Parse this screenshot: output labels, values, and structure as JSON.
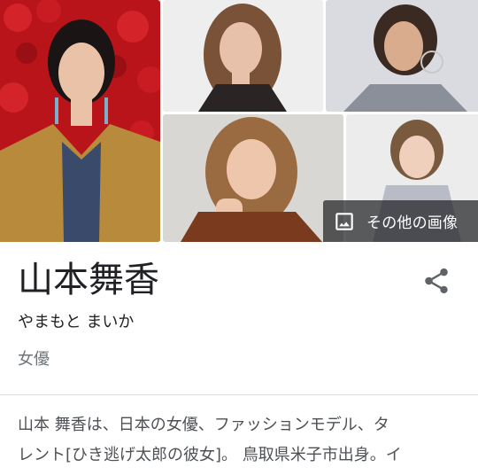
{
  "gallery": {
    "images": [
      {
        "name": "photo-1",
        "colors": {
          "bg": "#b8141a",
          "skin": "#e9c2a8",
          "hair": "#1b1414",
          "coat": "#b88a3c",
          "accent": "#3a4a6a"
        }
      },
      {
        "name": "photo-2",
        "colors": {
          "bg": "#eeeeee",
          "skin": "#e8c1aa",
          "hair": "#7a5238",
          "cloth": "#2a2424"
        }
      },
      {
        "name": "photo-3",
        "colors": {
          "bg": "#d9dbe0",
          "skin": "#d9ac8e",
          "hair": "#3a2a22",
          "cloth": "#8a8f9a"
        }
      },
      {
        "name": "photo-4",
        "colors": {
          "bg": "#d9d7d4",
          "skin": "#eec6ac",
          "hair": "#9a6a40",
          "cloth": "#7a3a1e"
        }
      },
      {
        "name": "photo-5",
        "colors": {
          "bg": "#ececec",
          "skin": "#efd0bd",
          "hair": "#7a5a3e",
          "cloth": "#b9bcc6"
        }
      }
    ],
    "more_images_label": "その他の画像",
    "more_images_icon": "image-icon"
  },
  "entity": {
    "title": "山本舞香",
    "reading": "やまもと まいか",
    "occupation": "女優",
    "share_icon": "share-icon"
  },
  "description": {
    "line1": "山本 舞香は、日本の女優、ファッションモデル、タ",
    "line2": "レント[ひき逃げ太郎の彼女]。 鳥取県米子市出身。イ"
  }
}
